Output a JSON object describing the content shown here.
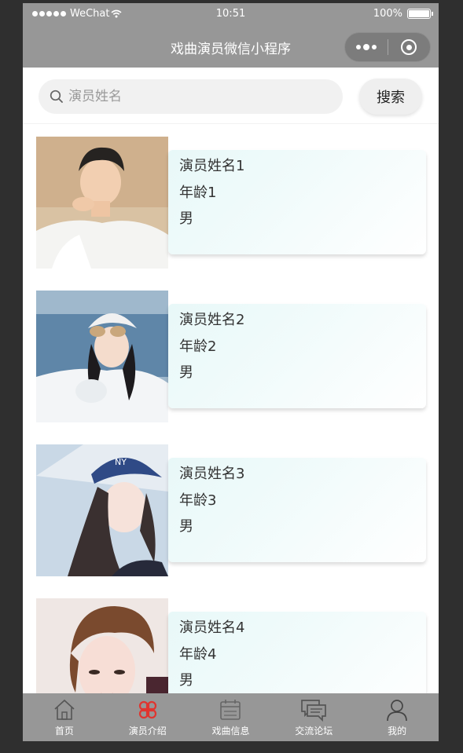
{
  "status_bar": {
    "carrier": "WeChat",
    "time": "10:51",
    "battery": "100%"
  },
  "nav": {
    "title": "戏曲演员微信小程序"
  },
  "search": {
    "placeholder": "演员姓名",
    "value": "",
    "button_label": "搜索"
  },
  "actors": [
    {
      "name": "演员姓名1",
      "age": "年龄1",
      "gender": "男"
    },
    {
      "name": "演员姓名2",
      "age": "年龄2",
      "gender": "男"
    },
    {
      "name": "演员姓名3",
      "age": "年龄3",
      "gender": "男"
    },
    {
      "name": "演员姓名4",
      "age": "年龄4",
      "gender": "男"
    }
  ],
  "tabbar": {
    "items": [
      {
        "label": "首页",
        "icon": "home-icon"
      },
      {
        "label": "演员介绍",
        "icon": "grid-clover-icon",
        "active": true
      },
      {
        "label": "戏曲信息",
        "icon": "calendar-icon"
      },
      {
        "label": "交流论坛",
        "icon": "chat-icon"
      },
      {
        "label": "我的",
        "icon": "user-icon"
      }
    ]
  },
  "colors": {
    "bar": "#979797",
    "active_tab": "#e0352f",
    "card_tint": "#e8f8f8"
  }
}
